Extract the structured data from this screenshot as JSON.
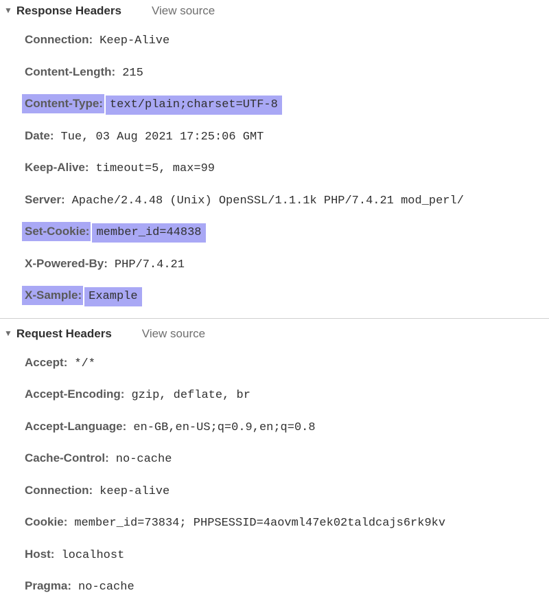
{
  "response": {
    "title": "Response Headers",
    "view_source": "View source",
    "headers": [
      {
        "name": "Connection",
        "value": "Keep-Alive",
        "highlight": false
      },
      {
        "name": "Content-Length",
        "value": "215",
        "highlight": false
      },
      {
        "name": "Content-Type",
        "value": "text/plain;charset=UTF-8",
        "highlight": true
      },
      {
        "name": "Date",
        "value": "Tue, 03 Aug 2021 17:25:06 GMT",
        "highlight": false
      },
      {
        "name": "Keep-Alive",
        "value": "timeout=5, max=99",
        "highlight": false
      },
      {
        "name": "Server",
        "value": "Apache/2.4.48 (Unix) OpenSSL/1.1.1k PHP/7.4.21 mod_perl/",
        "highlight": false
      },
      {
        "name": "Set-Cookie",
        "value": "member_id=44838",
        "highlight": true
      },
      {
        "name": "X-Powered-By",
        "value": "PHP/7.4.21",
        "highlight": false
      },
      {
        "name": "X-Sample",
        "value": "Example",
        "highlight": true
      }
    ]
  },
  "request": {
    "title": "Request Headers",
    "view_source": "View source",
    "headers": [
      {
        "name": "Accept",
        "value": "*/*",
        "highlight": false
      },
      {
        "name": "Accept-Encoding",
        "value": "gzip, deflate, br",
        "highlight": false
      },
      {
        "name": "Accept-Language",
        "value": "en-GB,en-US;q=0.9,en;q=0.8",
        "highlight": false
      },
      {
        "name": "Cache-Control",
        "value": "no-cache",
        "highlight": false
      },
      {
        "name": "Connection",
        "value": "keep-alive",
        "highlight": false
      },
      {
        "name": "Cookie",
        "value": "member_id=73834; PHPSESSID=4aovml47ek02taldcajs6rk9kv",
        "highlight": false
      },
      {
        "name": "Host",
        "value": "localhost",
        "highlight": false
      },
      {
        "name": "Pragma",
        "value": "no-cache",
        "highlight": false
      }
    ]
  },
  "icons": {
    "triangle": "▼"
  }
}
